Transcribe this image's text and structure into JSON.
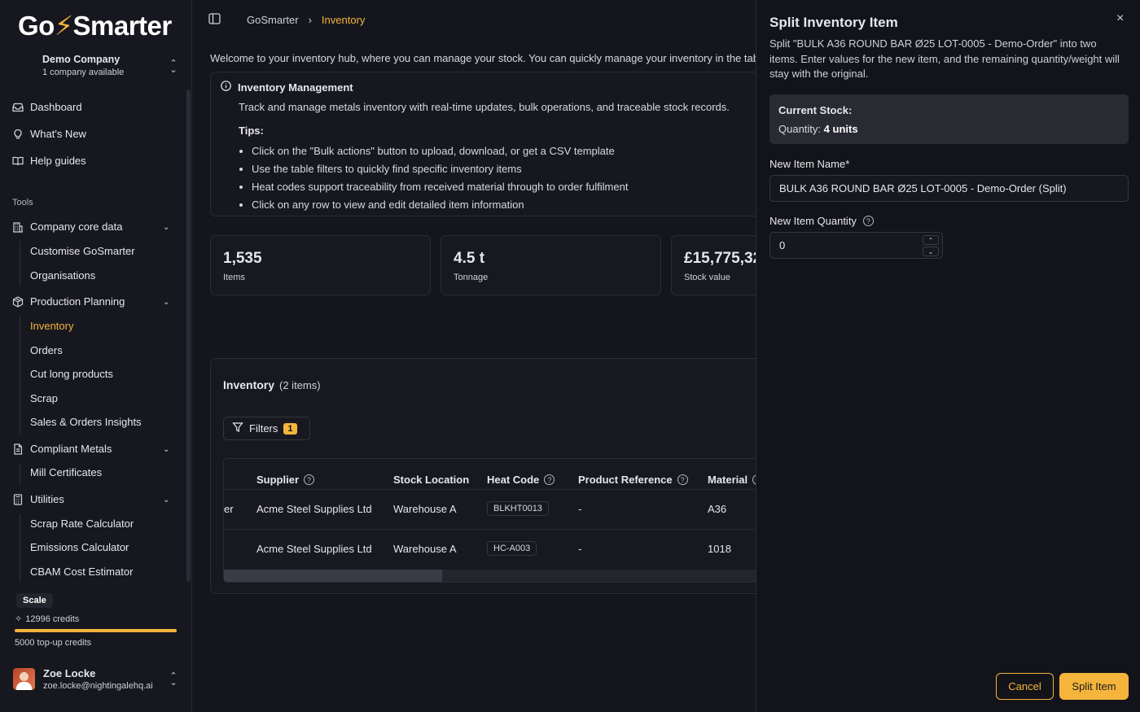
{
  "app": {
    "logo_prefix": "Go",
    "logo_bolt": "⚡",
    "logo_suffix": "Smarter"
  },
  "company": {
    "name": "Demo Company",
    "subtitle": "1 company available"
  },
  "nav": {
    "dashboard": "Dashboard",
    "whats_new": "What's New",
    "help": "Help guides"
  },
  "tools": {
    "label": "Tools",
    "company_core": "Company core data",
    "customise": "Customise GoSmarter",
    "organisations": "Organisations",
    "production": "Production Planning",
    "inventory": "Inventory",
    "orders": "Orders",
    "cut_long": "Cut long products",
    "scrap": "Scrap",
    "sales": "Sales & Orders Insights",
    "compliant": "Compliant Metals",
    "mill": "Mill Certificates",
    "utilities": "Utilities",
    "scrap_rate": "Scrap Rate Calculator",
    "emissions": "Emissions Calculator",
    "cbam": "CBAM Cost Estimator"
  },
  "plan": {
    "name": "Scale",
    "credits": "12996 credits",
    "topup": "5000 top-up credits"
  },
  "user": {
    "name": "Zoe Locke",
    "email": "zoe.locke@nightingalehq.ai"
  },
  "breadcrumb": {
    "root": "GoSmarter",
    "current": "Inventory"
  },
  "welcome": "Welcome to your inventory hub, where you can manage your stock. You can quickly manage your inventory in the table",
  "info": {
    "title": "Inventory Management",
    "desc": "Track and manage metals inventory with real-time updates, bulk operations, and traceable stock records.",
    "tips_label": "Tips:",
    "tips": [
      "Click on the \"Bulk actions\" button to upload, download, or get a CSV template",
      "Use the table filters to quickly find specific inventory items",
      "Heat codes support traceability from received material through to order fulfilment",
      "Click on any row to view and edit detailed item information"
    ]
  },
  "stats": [
    {
      "value": "1,535",
      "label": "Items"
    },
    {
      "value": "4.5 t",
      "label": "Tonnage"
    },
    {
      "value": "£15,775,32",
      "label": "Stock value"
    }
  ],
  "inventory": {
    "title": "Inventory",
    "count": "(2 items)",
    "filters_label": "Filters",
    "filters_count": "1",
    "columns": [
      "Supplier",
      "Stock Location",
      "Heat Code",
      "Product Reference",
      "Material"
    ],
    "rows": [
      {
        "lead": "er",
        "supplier": "Acme Steel Supplies Ltd",
        "location": "Warehouse A",
        "heat": "BLKHT0013",
        "ref": "-",
        "material": "A36"
      },
      {
        "lead": "",
        "supplier": "Acme Steel Supplies Ltd",
        "location": "Warehouse A",
        "heat": "HC-A003",
        "ref": "-",
        "material": "1018"
      }
    ]
  },
  "panel": {
    "title": "Split Inventory Item",
    "close": "×",
    "desc": "Split \"BULK A36 ROUND BAR Ø25 LOT-0005 - Demo-Order\" into two items. Enter values for the new item, and the remaining quantity/weight will stay with the original.",
    "stock_title": "Current Stock:",
    "qty_label": "Quantity:",
    "qty_value": "4 units",
    "name_label": "New Item Name*",
    "name_value": "BULK A36 ROUND BAR Ø25 LOT-0005 - Demo-Order (Split)",
    "qty_field_label": "New Item Quantity",
    "qty_field_value": "0",
    "cancel": "Cancel",
    "submit": "Split Item"
  }
}
